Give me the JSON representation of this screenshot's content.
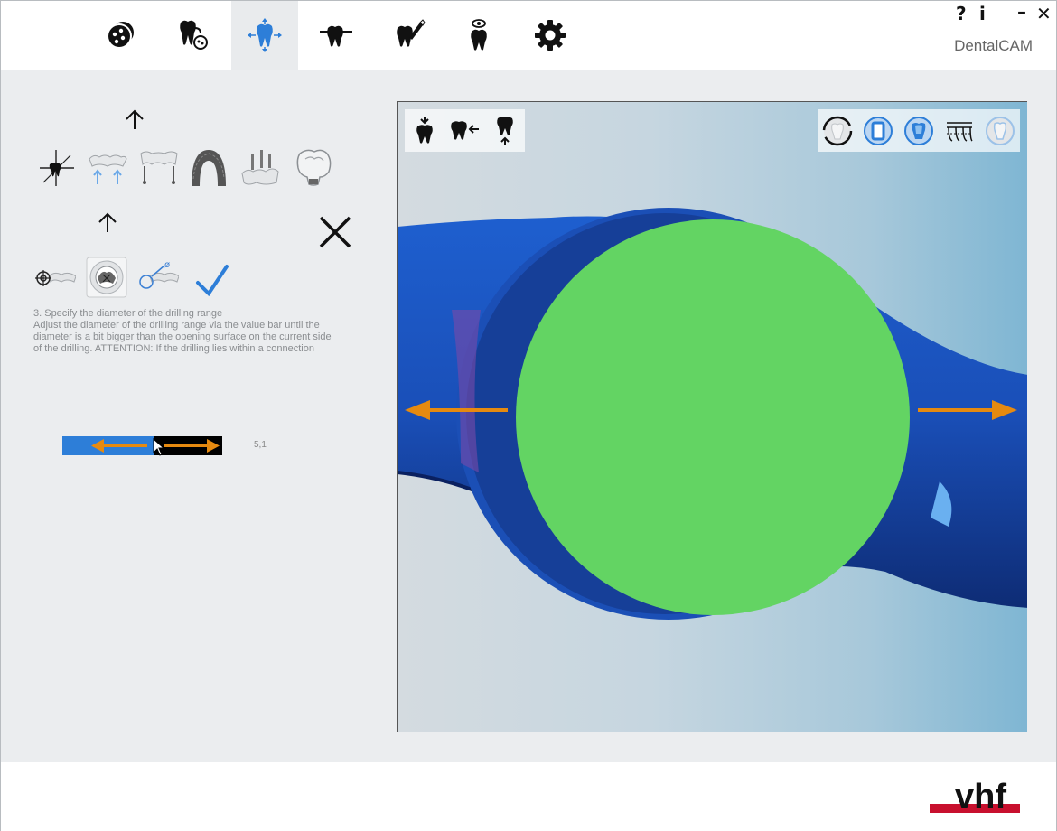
{
  "app": {
    "name": "DentalCAM"
  },
  "window_controls": {
    "help": "?",
    "info": "i",
    "minimize": "–",
    "close": "✕"
  },
  "toolbar": {
    "tabs": [
      {
        "icon": "material-disc-icon",
        "active": false
      },
      {
        "icon": "tooth-add-icon",
        "active": false
      },
      {
        "icon": "tooth-move-icon",
        "active": true
      },
      {
        "icon": "tooth-sprue-icon",
        "active": false
      },
      {
        "icon": "tooth-edit-icon",
        "active": false
      },
      {
        "icon": "tooth-view-icon",
        "active": false
      },
      {
        "icon": "settings-gear-icon",
        "active": false
      }
    ]
  },
  "left_panel": {
    "row1_icons": [
      "coordinate-tooth-icon",
      "bridge-align-icon",
      "bridge-connect-icon",
      "arch-icon",
      "implant-icon",
      "crown-icon"
    ],
    "row2_icons": [
      "target-tooth-icon",
      "drilling-disc-icon",
      "diameter-tooth-icon"
    ],
    "instruction_title": "3. Specify the diameter of the drilling range",
    "instruction_text": "Adjust the diameter of the drilling range via the value bar until the diameter is a bit bigger than the opening surface on the current side of the drilling. ATTENTION: If the drilling lies within a connection",
    "slider_value": "5,1",
    "slider_fraction": 0.57
  },
  "viewport": {
    "tools_left": [
      "tooth-top-view-icon",
      "tooth-side-view-icon",
      "tooth-bottom-view-icon"
    ],
    "tools_right": [
      "render-mode-outline-icon",
      "render-mode-solid-icon",
      "render-mode-shaded-icon",
      "render-mode-bridge-icon",
      "render-mode-transparent-icon"
    ]
  },
  "colors": {
    "accent": "#2d7ed8",
    "drill_disc": "#63d463",
    "model_blue": "#1a4fb8",
    "arrow": "#e68a10",
    "brand_red": "#c8102e"
  },
  "footer": {
    "logo_text": "vhf"
  }
}
